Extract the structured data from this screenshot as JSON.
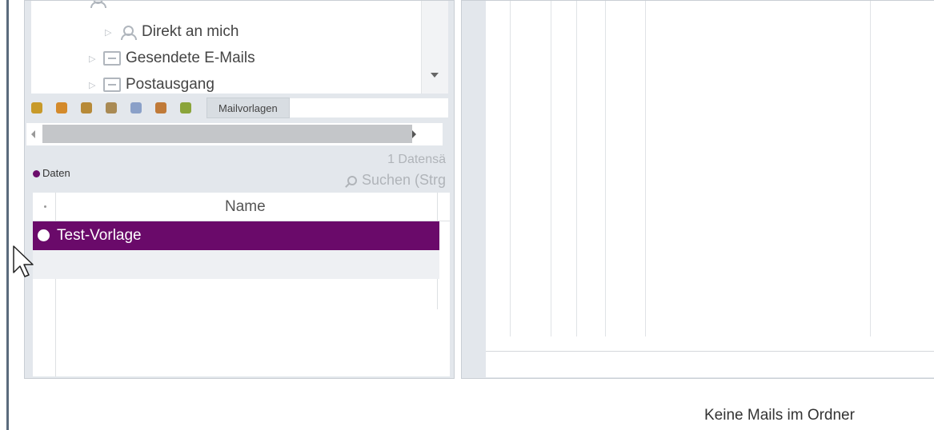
{
  "tree": {
    "items": [
      {
        "label": "Direkt an mich",
        "icon": "person-mail-icon"
      },
      {
        "label": "Gesendete E-Mails",
        "icon": "tray-icon"
      },
      {
        "label": "Postausgang",
        "icon": "outbox-icon"
      }
    ]
  },
  "toolbar": {
    "icons": [
      {
        "name": "contacts-icon",
        "color": "#c89a2a"
      },
      {
        "name": "phone-icon",
        "color": "#d48a2b"
      },
      {
        "name": "group-icon",
        "color": "#b78a38"
      },
      {
        "name": "binoculars-icon",
        "color": "#a98a54"
      },
      {
        "name": "mail-stack-icon",
        "color": "#8aa0c8"
      },
      {
        "name": "user-icon",
        "color": "#c07a38"
      },
      {
        "name": "report-icon",
        "color": "#8aa43a"
      }
    ],
    "active_tab": "Mailvorlagen"
  },
  "grid": {
    "group_label": "Daten",
    "record_count": "1 Datensä",
    "search_placeholder": "Suchen (Strg",
    "column_name": "Name",
    "rows": [
      {
        "name": "Test-Vorlage",
        "selected": true
      }
    ]
  },
  "status": {
    "text": "Keine Mails im Ordner"
  },
  "colors": {
    "accent": "#6a0a6a",
    "panel_bg": "#e3e7ec"
  }
}
